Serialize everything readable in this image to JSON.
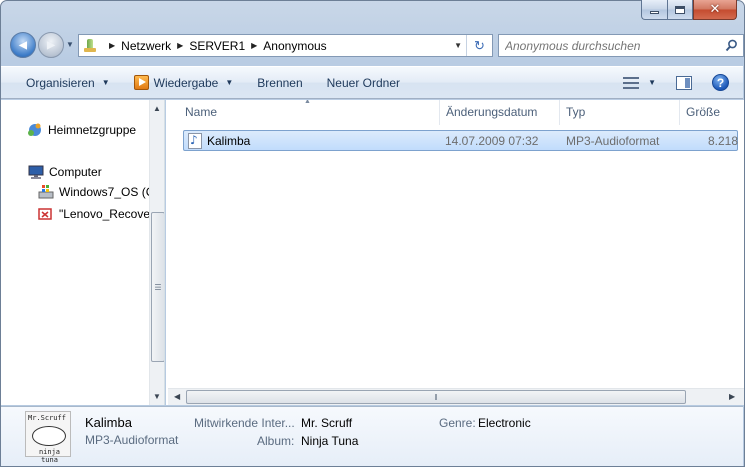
{
  "window": {
    "caption_min": "–",
    "caption_close": "✕"
  },
  "nav": {
    "back_glyph": "◀",
    "forward_glyph": "▶",
    "breadcrumb": [
      "Netzwerk",
      "SERVER1",
      "Anonymous"
    ],
    "search_placeholder": "Anonymous durchsuchen"
  },
  "toolbar": {
    "organize": "Organisieren",
    "play": "Wiedergabe",
    "burn": "Brennen",
    "new_folder": "Neuer Ordner"
  },
  "navpane": {
    "items": [
      {
        "label": "Heimnetzgruppe",
        "icon": "homegroup-icon"
      },
      {
        "label": "Computer",
        "icon": "computer-icon"
      },
      {
        "label": "Windows7_OS (C",
        "icon": "drive-icon"
      },
      {
        "label": "\"Lenovo_Recover",
        "icon": "recovery-drive-icon"
      }
    ]
  },
  "columns": {
    "name": "Name",
    "date": "Änderungsdatum",
    "type": "Typ",
    "size": "Größe"
  },
  "files": [
    {
      "name": "Kalimba",
      "date": "14.07.2009 07:32",
      "type": "MP3-Audioformat",
      "size": "8.218"
    }
  ],
  "details": {
    "thumb_line1": "Mr.Scruff",
    "thumb_line2": "ninja tuna",
    "name": "Kalimba",
    "type": "MP3-Audioformat",
    "artists_label": "Mitwirkende Inter...",
    "artists_value": "Mr. Scruff",
    "album_label": "Album:",
    "album_value": "Ninja Tuna",
    "genre_label": "Genre:",
    "genre_value": "Electronic"
  }
}
